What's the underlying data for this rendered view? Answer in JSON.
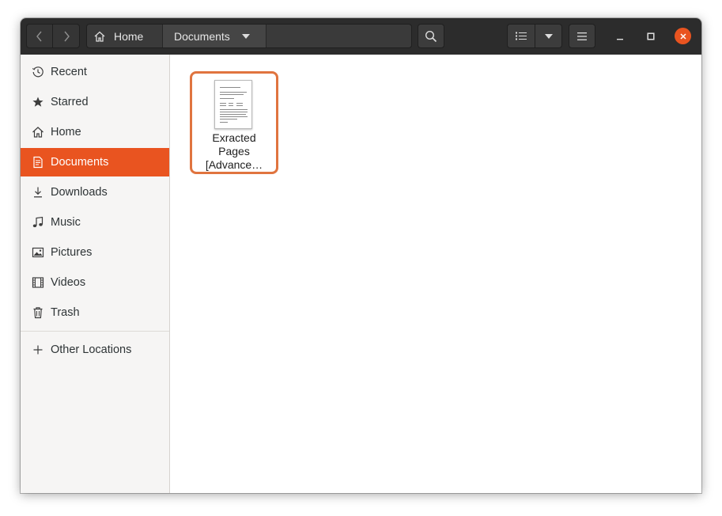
{
  "nav": {
    "back_icon": "chevron-left-icon",
    "forward_icon": "chevron-right-icon"
  },
  "pathbar": {
    "home_label": "Home",
    "current_label": "Documents"
  },
  "toolbar": {
    "search_icon": "search-icon",
    "view_icon": "list-view-icon",
    "view_dropdown_icon": "chevron-down-icon",
    "menu_icon": "hamburger-menu-icon"
  },
  "window_controls": {
    "minimize_icon": "minimize-icon",
    "maximize_icon": "maximize-icon",
    "close_icon": "close-icon",
    "close_color": "#e95420"
  },
  "sidebar": {
    "items": [
      {
        "label": "Recent",
        "icon": "clock-icon"
      },
      {
        "label": "Starred",
        "icon": "star-icon"
      },
      {
        "label": "Home",
        "icon": "home-icon"
      },
      {
        "label": "Documents",
        "icon": "document-icon",
        "active": true
      },
      {
        "label": "Downloads",
        "icon": "download-icon"
      },
      {
        "label": "Music",
        "icon": "music-icon"
      },
      {
        "label": "Pictures",
        "icon": "picture-icon"
      },
      {
        "label": "Videos",
        "icon": "video-icon"
      },
      {
        "label": "Trash",
        "icon": "trash-icon"
      }
    ],
    "other_locations": {
      "label": "Other Locations",
      "icon": "plus-icon"
    }
  },
  "files": [
    {
      "name_lines": [
        "Exracted",
        "Pages",
        "[Advance…"
      ],
      "icon": "pdf-document-thumbnail",
      "selected": true
    }
  ],
  "colors": {
    "accent": "#e95420",
    "headerbar": "#2c2c2c",
    "selection_border": "#e0743f"
  }
}
